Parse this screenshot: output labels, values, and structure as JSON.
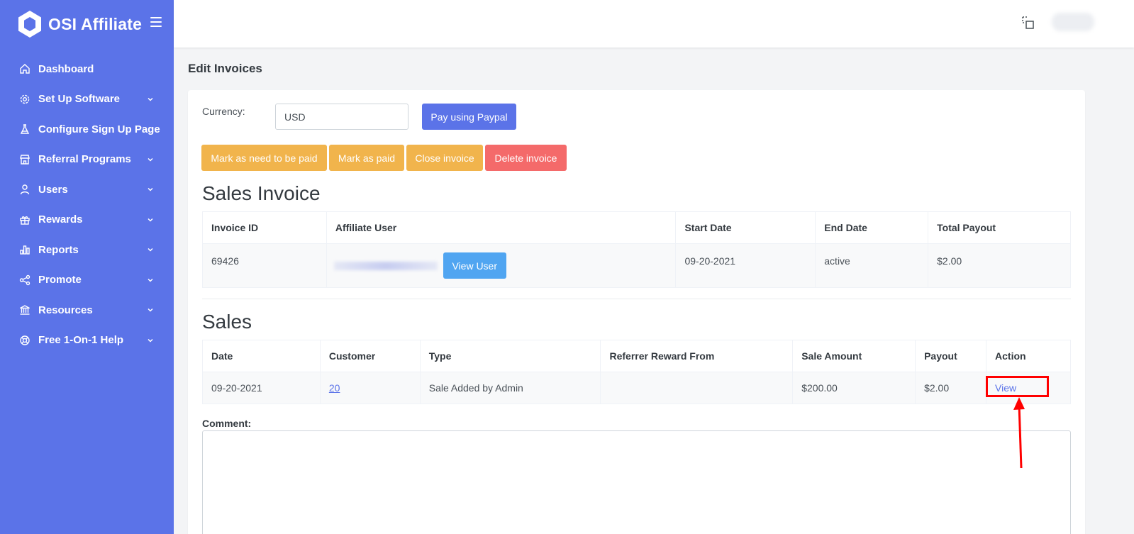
{
  "brand": {
    "name": "OSI Affiliate"
  },
  "sidebar": {
    "items": [
      {
        "label": "Dashboard",
        "icon": "home-icon",
        "has_submenu": false
      },
      {
        "label": "Set Up Software",
        "icon": "gear-icon",
        "has_submenu": true
      },
      {
        "label": "Configure Sign Up Page",
        "icon": "flask-icon",
        "has_submenu": false
      },
      {
        "label": "Referral Programs",
        "icon": "store-icon",
        "has_submenu": true
      },
      {
        "label": "Users",
        "icon": "user-icon",
        "has_submenu": true
      },
      {
        "label": "Rewards",
        "icon": "gift-icon",
        "has_submenu": true
      },
      {
        "label": "Reports",
        "icon": "bar-chart-icon",
        "has_submenu": true
      },
      {
        "label": "Promote",
        "icon": "share-icon",
        "has_submenu": true
      },
      {
        "label": "Resources",
        "icon": "bank-icon",
        "has_submenu": true
      },
      {
        "label": "Free 1-On-1 Help",
        "icon": "lifebuoy-icon",
        "has_submenu": true
      }
    ]
  },
  "page": {
    "title": "Edit Invoices"
  },
  "currency": {
    "label": "Currency:",
    "value": "USD"
  },
  "buttons": {
    "pay_paypal": "Pay using Paypal",
    "mark_need_paid": "Mark as need to be paid",
    "mark_paid": "Mark as paid",
    "close_invoice": "Close invoice",
    "delete_invoice": "Delete invoice",
    "view_user": "View User"
  },
  "invoice": {
    "title": "Sales Invoice",
    "headers": [
      "Invoice ID",
      "Affiliate User",
      "Start Date",
      "End Date",
      "Total Payout"
    ],
    "row": {
      "invoice_id": "69426",
      "start_date": "09-20-2021",
      "end_date": "active",
      "total_payout": "$2.00"
    }
  },
  "sales": {
    "title": "Sales",
    "headers": [
      "Date",
      "Customer",
      "Type",
      "Referrer Reward From",
      "Sale Amount",
      "Payout",
      "Action"
    ],
    "rows": [
      {
        "date": "09-20-2021",
        "customer": "20",
        "type": "Sale Added by Admin",
        "referrer_reward_from": "",
        "sale_amount": "$200.00",
        "payout": "$2.00",
        "action": "View"
      }
    ]
  },
  "comment": {
    "label": "Comment:"
  },
  "colors": {
    "sidebar": "#5b73e8",
    "primary": "#5b73e8",
    "warning": "#f1b44c",
    "danger": "#f46a6a",
    "info": "#50a5f1",
    "annotation": "#ff0000"
  }
}
